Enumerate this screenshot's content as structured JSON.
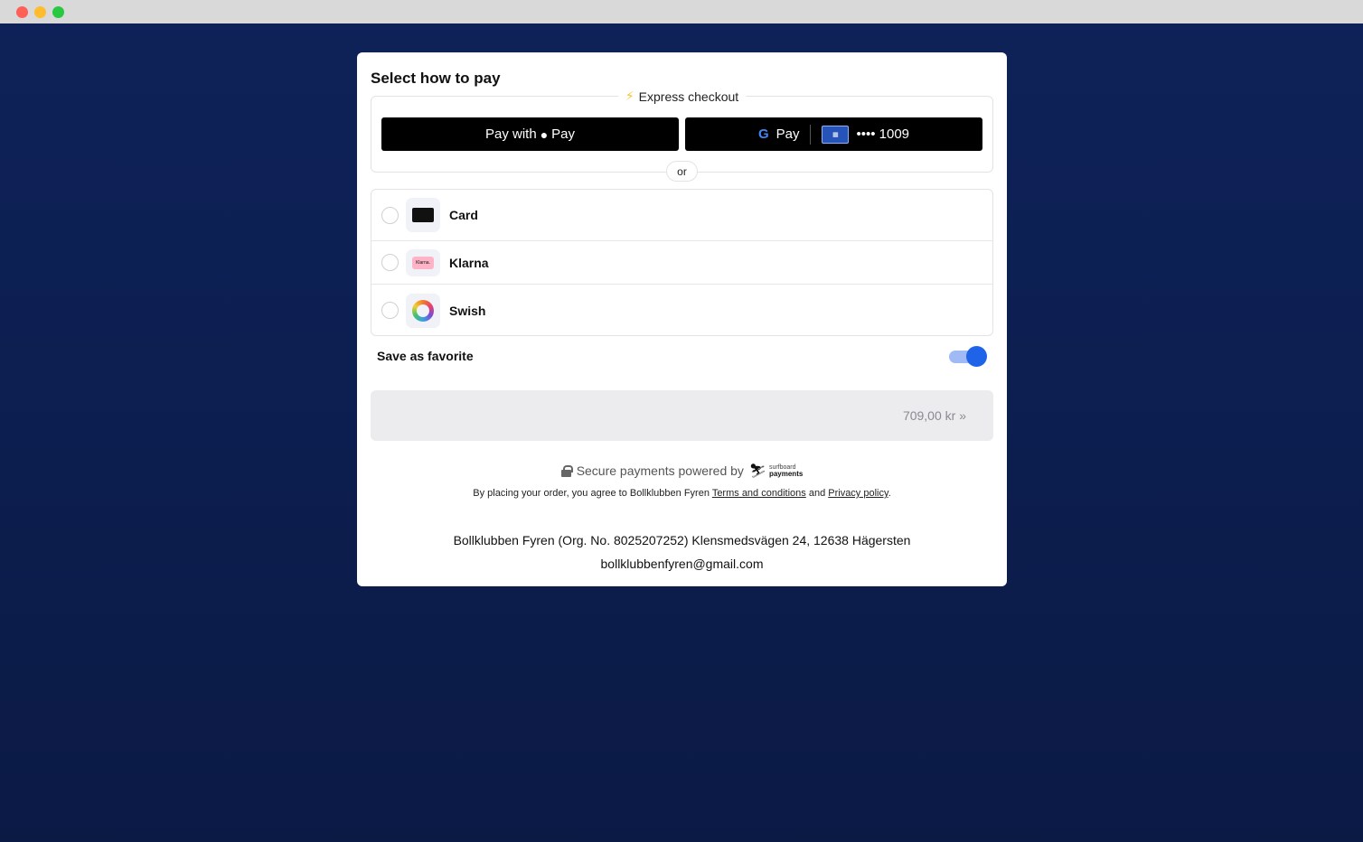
{
  "window": {
    "controls": [
      "close",
      "minimize",
      "maximize"
    ]
  },
  "checkout": {
    "heading": "Select how to pay",
    "express_label": "Express checkout",
    "apple_pay": {
      "prefix": "Pay with",
      "brand": "Pay"
    },
    "google_pay": {
      "g": "G",
      "brand": "Pay",
      "card_masked": "•••• 1009"
    },
    "separator": "or",
    "methods": [
      {
        "label": "Card",
        "icon": "card-icon"
      },
      {
        "label": "Klarna",
        "icon": "klarna-icon",
        "badge": "Klarna."
      },
      {
        "label": "Swish",
        "icon": "swish-icon"
      }
    ],
    "favorite_label": "Save as favorite",
    "favorite_on": true,
    "submit_label": "709,00 kr »",
    "secure_text": "Secure payments powered by",
    "provider": {
      "top": "surfboard",
      "bottom": "payments"
    },
    "terms": {
      "prefix": "By placing your order, you agree to Bollklubben Fyren",
      "terms_link": "Terms and conditions",
      "middle": "and",
      "privacy_link": "Privacy policy",
      "suffix": "."
    },
    "org_line": "Bollklubben Fyren (Org. No. 8025207252)  Klensmedsvägen 24, 12638 Hägersten",
    "email": "bollklubbenfyren@gmail.com"
  },
  "colors": {
    "background": "#0c1f4f",
    "accent": "#1f63e9",
    "panel": "#ffffff"
  }
}
